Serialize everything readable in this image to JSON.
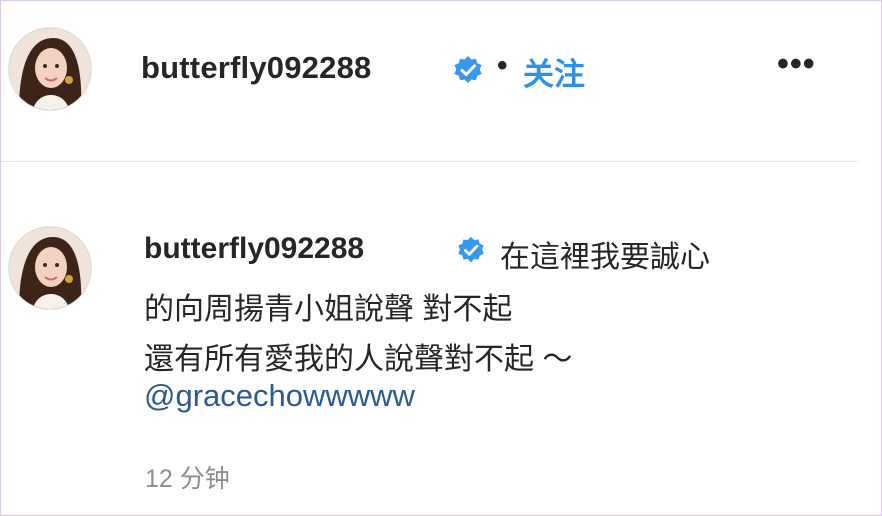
{
  "post_header": {
    "username": "butterfly092288",
    "separator": "•",
    "follow_label": "关注",
    "more_label": "•••",
    "avatar_icon": "profile-photo",
    "verified_icon": "verified-badge-icon",
    "verified_color": "#3897f0"
  },
  "comment": {
    "username": "butterfly092288",
    "line1": "在這裡我要誠心",
    "line2": "的向周揚青小姐說聲 對不起",
    "line3": "還有所有愛我的人說聲對不起 ～",
    "mention": "@gracechowwwww",
    "timestamp": "12 分钟"
  },
  "colors": {
    "link_blue": "#2f91e6",
    "mention_blue": "#2b5a92",
    "text_dark": "#262626",
    "text_muted": "#8e8e8e"
  }
}
